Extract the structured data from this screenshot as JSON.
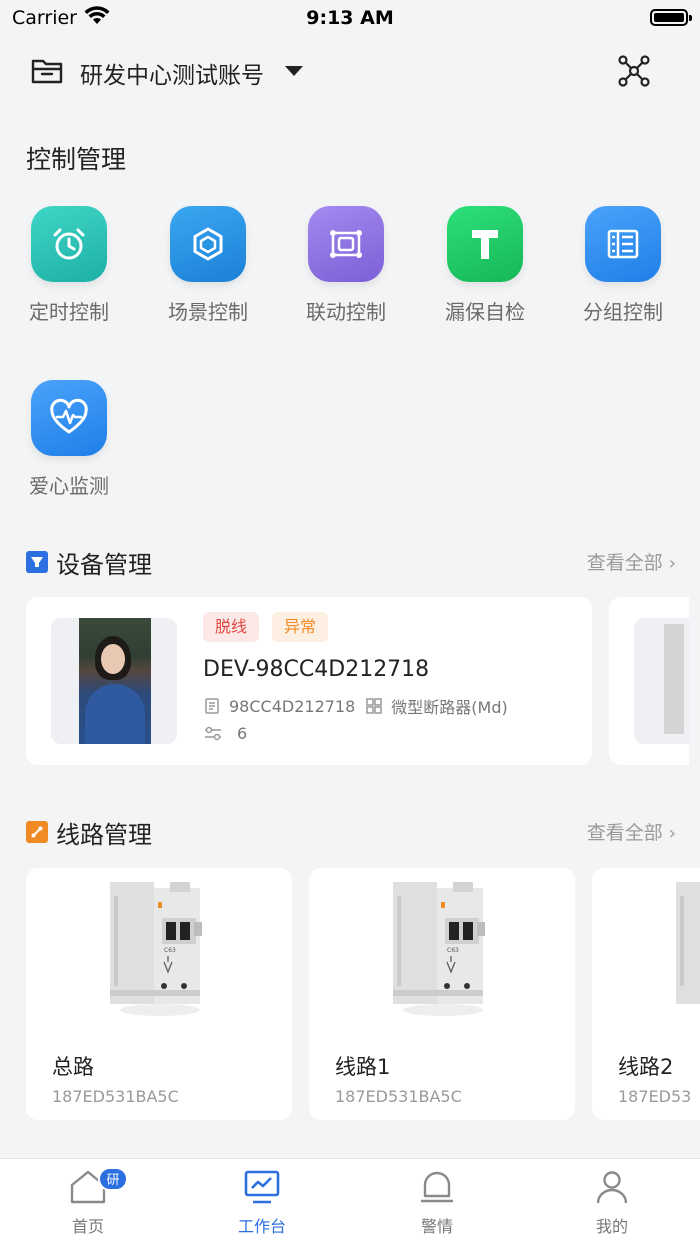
{
  "status_bar": {
    "carrier": "Carrier",
    "time": "9:13 AM"
  },
  "header": {
    "account_name": "研发中心测试账号"
  },
  "control": {
    "title": "控制管理",
    "items": [
      {
        "label": "定时控制",
        "icon": "alarm-clock-icon",
        "color": "#22c3b6"
      },
      {
        "label": "场景控制",
        "icon": "scene-cube-icon",
        "color": "#1f8fe6"
      },
      {
        "label": "联动控制",
        "icon": "linkage-icon",
        "color": "#8d6fe0"
      },
      {
        "label": "漏保自检",
        "icon": "t-test-icon",
        "color": "#1fc965"
      },
      {
        "label": "分组控制",
        "icon": "group-list-icon",
        "color": "#2e8ef5"
      },
      {
        "label": "爱心监测",
        "icon": "heart-monitor-icon",
        "color": "#2e8ef5"
      }
    ]
  },
  "devices": {
    "title": "设备管理",
    "more": "查看全部",
    "card": {
      "tags": [
        "脱线",
        "异常"
      ],
      "name": "DEV-98CC4D212718",
      "serial": "98CC4D212718",
      "model": "微型断路器(Md)",
      "count": "6"
    }
  },
  "circuits": {
    "title": "线路管理",
    "more": "查看全部",
    "items": [
      {
        "name": "总路",
        "id": "187ED531BA5C"
      },
      {
        "name": "线路1",
        "id": "187ED531BA5C"
      },
      {
        "name": "线路2",
        "id": "187ED53"
      }
    ]
  },
  "tabbar": {
    "tabs": [
      {
        "label": "首页",
        "badge": "研"
      },
      {
        "label": "工作台"
      },
      {
        "label": "警情"
      },
      {
        "label": "我的"
      }
    ],
    "active_color": "#2c6fe0"
  }
}
